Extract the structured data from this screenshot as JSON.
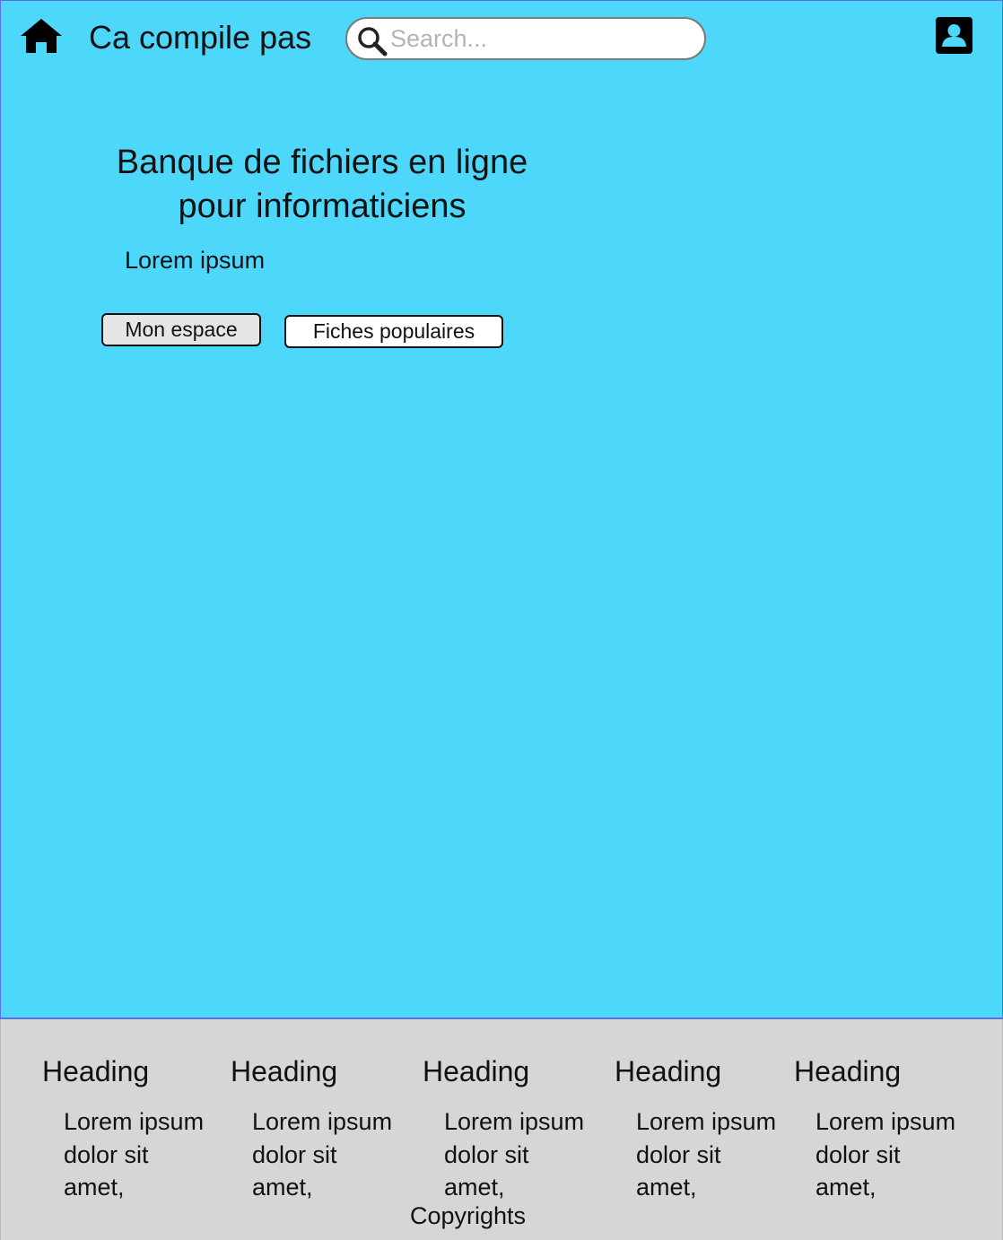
{
  "header": {
    "brand": "Ca compile pas",
    "search_placeholder": "Search..."
  },
  "hero": {
    "title": "Banque de fichiers en ligne pour informaticiens",
    "subtitle": "Lorem ipsum",
    "btn_space": "Mon espace",
    "btn_popular": "Fiches populaires"
  },
  "footer": {
    "columns": [
      {
        "heading": "Heading",
        "text": "Lorem ipsum dolor sit amet,"
      },
      {
        "heading": "Heading",
        "text": "Lorem ipsum dolor sit amet,"
      },
      {
        "heading": "Heading",
        "text": "Lorem ipsum dolor sit amet,"
      },
      {
        "heading": "Heading",
        "text": "Lorem ipsum dolor sit amet,"
      },
      {
        "heading": "Heading",
        "text": "Lorem ipsum dolor sit amet,"
      }
    ],
    "copyright": "Copyrights"
  },
  "colors": {
    "background": "#4dd7fa",
    "footer": "#d6d6d6",
    "border": "#5b6ee0"
  },
  "icons": {
    "home": "home-icon",
    "search": "search-icon",
    "account": "account-icon"
  }
}
